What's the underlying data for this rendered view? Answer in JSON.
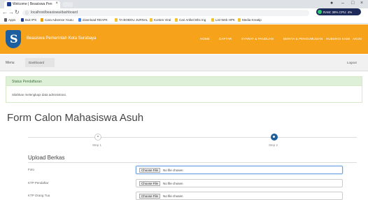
{
  "browser": {
    "tab_title": "Welcome | Beasiswa Pen",
    "url": "localhost/beasiswa/dashboard",
    "bookmarks": [
      "Apps",
      "Buk IPS",
      "Cara Adsense Youtu",
      "download REAPK",
      "TA BOBOU JURNAL",
      "Konten Viral",
      "Cari Artikel Bhs Ing",
      "List Web HPK",
      "Media Kreatip"
    ],
    "sysmon_text": "RAM: 39%   CPU: 4%"
  },
  "navbar": {
    "brand": "Beasiswa Pemerintah Kota Surabaya",
    "links": [
      "HOME",
      "DAFTAR",
      "SYARAT & PANDUAN",
      "BERITA & PENGUMUMAN",
      "HUBUNGI KAMI",
      "AKUN"
    ]
  },
  "subnav": {
    "menu": "Menu",
    "dashboard": "Dashboard",
    "logout": "Logout"
  },
  "status": {
    "title": "Status Pendaftaran",
    "message": "Silahkan melengkapi data administrasi."
  },
  "form": {
    "title": "Form Calon Mahasiswa Asuh",
    "steps": [
      {
        "label": "Step 1",
        "active": false
      },
      {
        "label": "Step 2",
        "active": true
      }
    ],
    "section": "Upload Berkas",
    "fields": [
      {
        "label": "Foto",
        "button": "Choose File",
        "value": "No file chosen"
      },
      {
        "label": "KTP Pendaftar",
        "button": "Choose File",
        "value": "No file chosen"
      },
      {
        "label": "KTP Orang Tua",
        "button": "Choose File",
        "value": "No file chosen"
      }
    ]
  },
  "colors": {
    "navbar": "#f7a21b",
    "step_active": "#1d5f9e",
    "status_head": "#dff0d8"
  }
}
